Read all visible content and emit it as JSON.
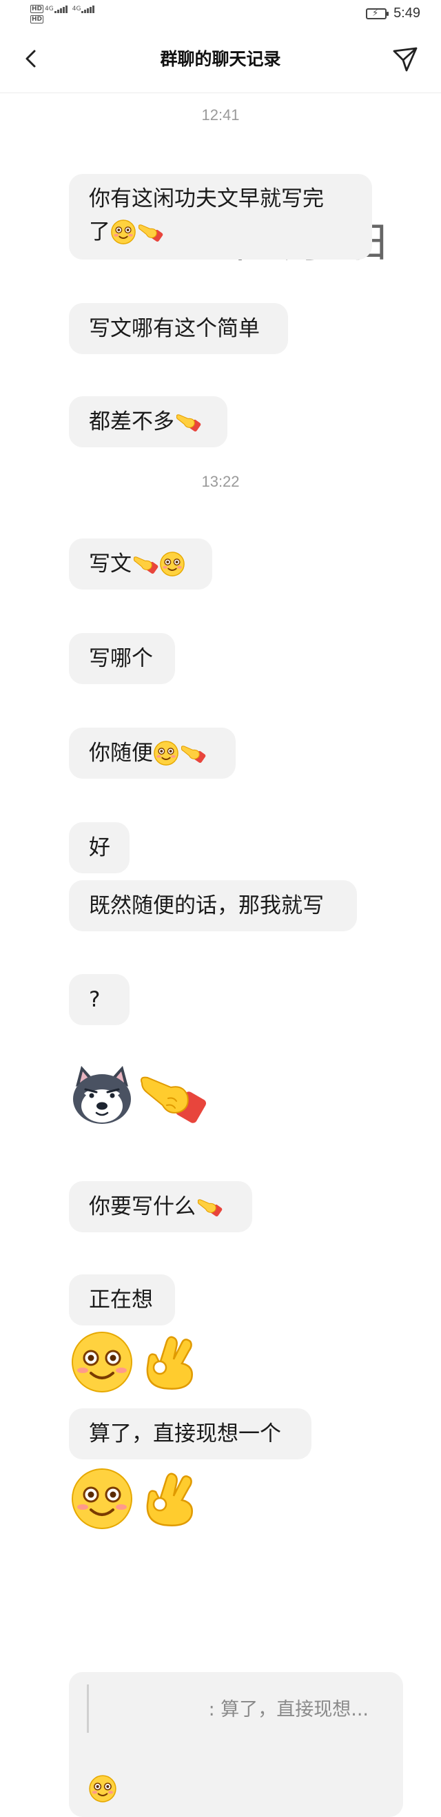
{
  "status_bar": {
    "hd_label": "HD",
    "network_1": "4G",
    "network_2": "4G",
    "time": "5:49"
  },
  "header": {
    "title": "群聊的聊天记录",
    "back_icon": "chevron-left-icon",
    "action_icon": "send-icon"
  },
  "chat": {
    "date_overlay": "2024年9月7日",
    "timestamp_1": "12:41",
    "timestamp_2": "13:22",
    "messages": [
      {
        "line1": "你有这闲功夫文早就写完",
        "line2": "了"
      },
      {
        "text": "写文哪有这个简单"
      },
      {
        "text": "都差不多"
      },
      {
        "text": "写文"
      },
      {
        "text": "写哪个"
      },
      {
        "text": "你随便"
      },
      {
        "text": "好"
      },
      {
        "text": "既然随便的话，那我就写"
      },
      {
        "text": "?"
      },
      {
        "text": "你要写什么"
      },
      {
        "text": "正在想"
      },
      {
        "text": "算了，直接现想一个"
      }
    ],
    "reply": {
      "quote": ": 算了，直接现想..."
    }
  },
  "colors": {
    "bubble_bg": "#f2f2f2",
    "timestamp": "#9a9a9a",
    "text": "#1a1a1a"
  }
}
